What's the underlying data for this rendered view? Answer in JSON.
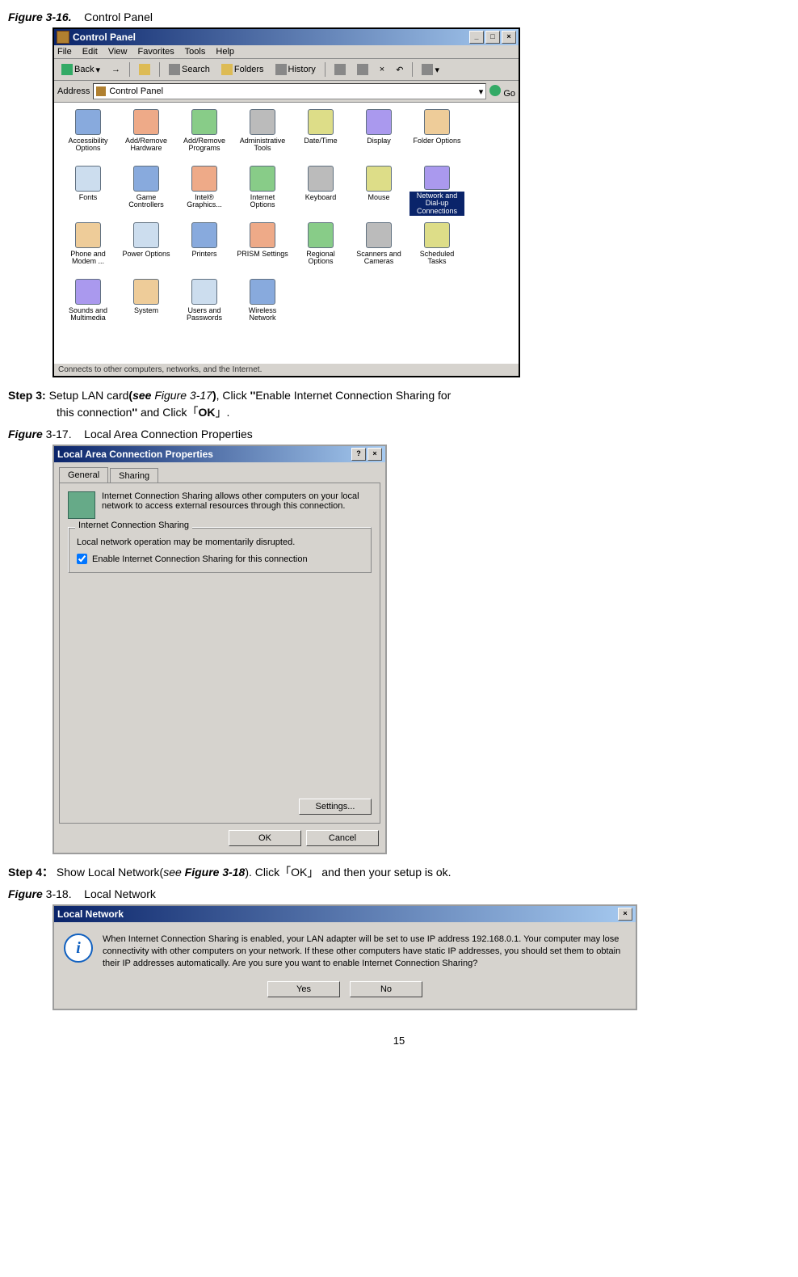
{
  "figure316": {
    "label": "Figure 3-16.",
    "text": "Control Panel"
  },
  "controlPanel": {
    "title": "Control Panel",
    "menu": [
      "File",
      "Edit",
      "View",
      "Favorites",
      "Tools",
      "Help"
    ],
    "toolbar": {
      "back": "Back",
      "search": "Search",
      "folders": "Folders",
      "history": "History"
    },
    "addressLabel": "Address",
    "addressValue": "Control Panel",
    "go": "Go",
    "items": [
      "Accessibility Options",
      "Add/Remove Hardware",
      "Add/Remove Programs",
      "Administrative Tools",
      "Date/Time",
      "Display",
      "Folder Options",
      "Fonts",
      "Game Controllers",
      "Intel® Graphics...",
      "Internet Options",
      "Keyboard",
      "Mouse",
      "Network and Dial-up Connections",
      "Phone and Modem ...",
      "Power Options",
      "Printers",
      "PRISM Settings",
      "Regional Options",
      "Scanners and Cameras",
      "Scheduled Tasks",
      "Sounds and Multimedia",
      "System",
      "Users and Passwords",
      "Wireless Network"
    ],
    "selectedIndex": 13,
    "status": "Connects to other computers, networks, and the Internet."
  },
  "step3": {
    "prefix": "Step 3:",
    "line1a": " Setup LAN card",
    "line1b": "(",
    "see": "see",
    "figref": " Figure 3-17",
    "line1c": ")",
    "line1d": ", Click ",
    "q1": "''",
    "enable": "Enable Internet Connection Sharing for",
    "line2a": "this connection",
    "q2": "''",
    "line2b": " and Click「",
    "ok": "OK",
    "line2c": "」."
  },
  "figure317": {
    "label": "Figure",
    "num": "3-17.",
    "text": "Local Area Connection Properties"
  },
  "propsDialog": {
    "title": "Local Area Connection Properties",
    "tabs": {
      "general": "General",
      "sharing": "Sharing"
    },
    "infoText": "Internet Connection Sharing allows other computers on your local network to access external resources through this connection.",
    "groupLabel": "Internet Connection Sharing",
    "warning": "Local network operation may be momentarily disrupted.",
    "checkbox": "Enable Internet Connection Sharing for this connection",
    "settings": "Settings...",
    "ok": "OK",
    "cancel": "Cancel"
  },
  "step4": {
    "prefix": "Step 4：",
    "t1": " Show Local Network(",
    "see": "see ",
    "figref": "Figure 3-18",
    "t2": "). Click「OK」 and then your setup is ok."
  },
  "figure318": {
    "label": "Figure",
    "num": "3-18.",
    "text": "Local Network"
  },
  "msgBox": {
    "title": "Local Network",
    "body": "When Internet Connection Sharing is enabled, your LAN adapter will be set to use IP address 192.168.0.1. Your computer may lose connectivity with other computers on your network. If these other computers have static IP addresses, you should set them to obtain their IP addresses automatically. Are you sure you want to enable Internet Connection Sharing?",
    "yes": "Yes",
    "no": "No"
  },
  "pageNumber": "15"
}
